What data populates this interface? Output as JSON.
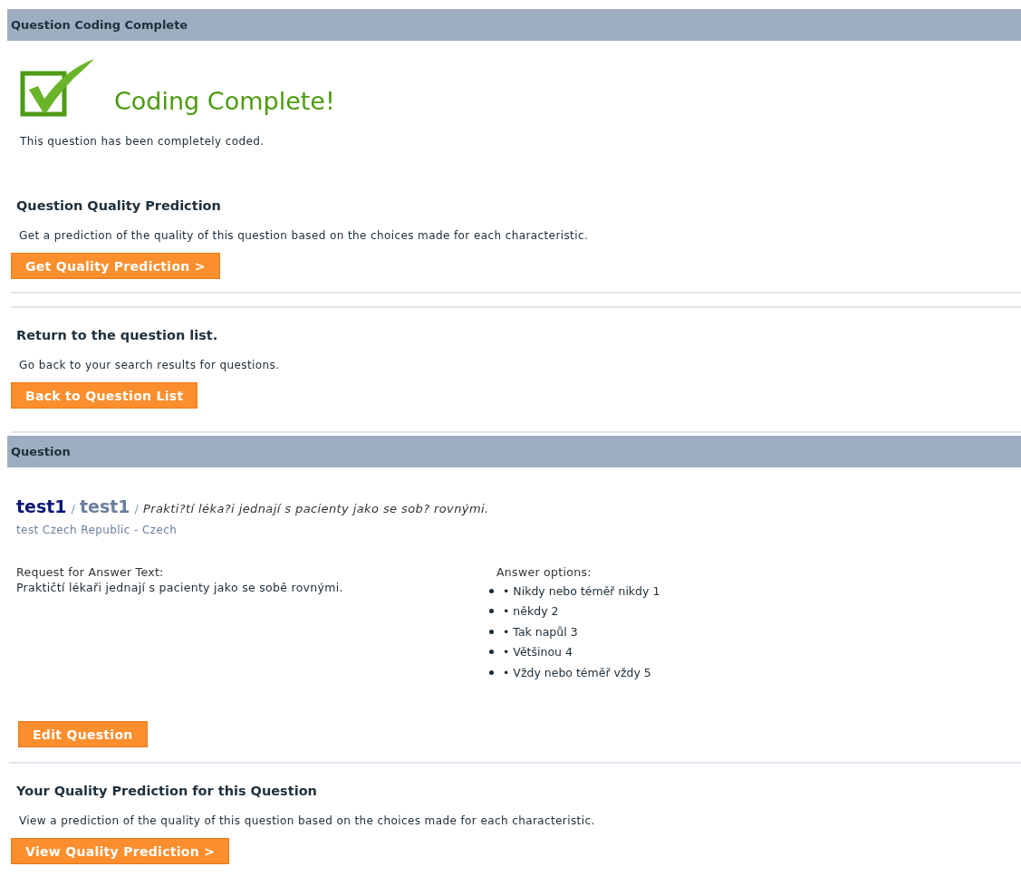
{
  "complete_panel": {
    "header": "Question Coding Complete",
    "title": "Coding Complete!",
    "message": "This question has been completely coded.",
    "actions": [
      {
        "heading": "Question Quality Prediction",
        "description": "Get a prediction of the quality of this question based on the choices made for each characteristic.",
        "button": "Get Quality Prediction >"
      },
      {
        "heading": "Return to the question list.",
        "description": "Go back to your search results for questions.",
        "button": "Back to Question List"
      }
    ]
  },
  "question_panel": {
    "header": "Question",
    "breadcrumb": [
      "test1",
      "/",
      "test1",
      "/",
      "Prakti?tí léka?i jednají s pacienty jako se sob? rovnými."
    ],
    "subtitle": "test Czech Republic - Czech",
    "request_label": "Request for Answer Text:",
    "request_text": "Praktičtí lékaři jednají s pacienty jako se sobě rovnými.",
    "options_label": "Answer options:",
    "options": [
      "• Nikdy nebo téměř nikdy 1",
      "• někdy 2",
      "• Tak napůl 3",
      "• Většinou 4",
      "• Vždy nebo téměř vždy 5"
    ],
    "edit_button": "Edit Question",
    "prediction": {
      "heading": "Your Quality Prediction for this Question",
      "description": "View a prediction of the quality of this question based on the choices made for each characteristic.",
      "button": "View Quality Prediction >"
    }
  }
}
